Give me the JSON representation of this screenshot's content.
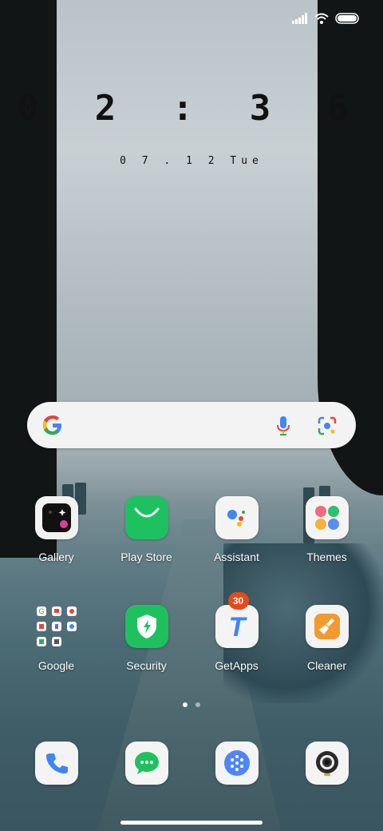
{
  "lockscreen": {
    "time": "0 2 : 3 6",
    "date": "0 7 . 1 2   Tue"
  },
  "status_bar": {
    "signal_icon": "signal-icon",
    "wifi_icon": "wifi-icon",
    "battery_icon": "battery-icon"
  },
  "search_bar": {
    "google_logo": "google-g-icon",
    "voice_icon": "microphone-icon",
    "lens_icon": "google-lens-icon"
  },
  "apps_row1": [
    {
      "label": "Gallery",
      "icon": "gallery-icon"
    },
    {
      "label": "Play Store",
      "icon": "play-store-icon"
    },
    {
      "label": "Assistant",
      "icon": "assistant-icon"
    },
    {
      "label": "Themes",
      "icon": "themes-icon"
    }
  ],
  "apps_row2": [
    {
      "label": "Google",
      "icon": "google-folder-icon"
    },
    {
      "label": "Security",
      "icon": "security-icon"
    },
    {
      "label": "GetApps",
      "icon": "getapps-icon",
      "badge": "30"
    },
    {
      "label": "Cleaner",
      "icon": "cleaner-icon"
    }
  ],
  "dock": [
    {
      "icon": "phone-icon"
    },
    {
      "icon": "messages-icon"
    },
    {
      "icon": "app-drawer-icon"
    },
    {
      "icon": "camera-icon"
    }
  ],
  "page_indicator": {
    "pages": 2,
    "active": 0
  },
  "colors": {
    "play_store_green": "#1ec15f",
    "security_green": "#1fc15e",
    "cleaner_orange": "#f29a2e",
    "badge_red": "#e64a19",
    "dock_blue": "#4f86f7"
  }
}
